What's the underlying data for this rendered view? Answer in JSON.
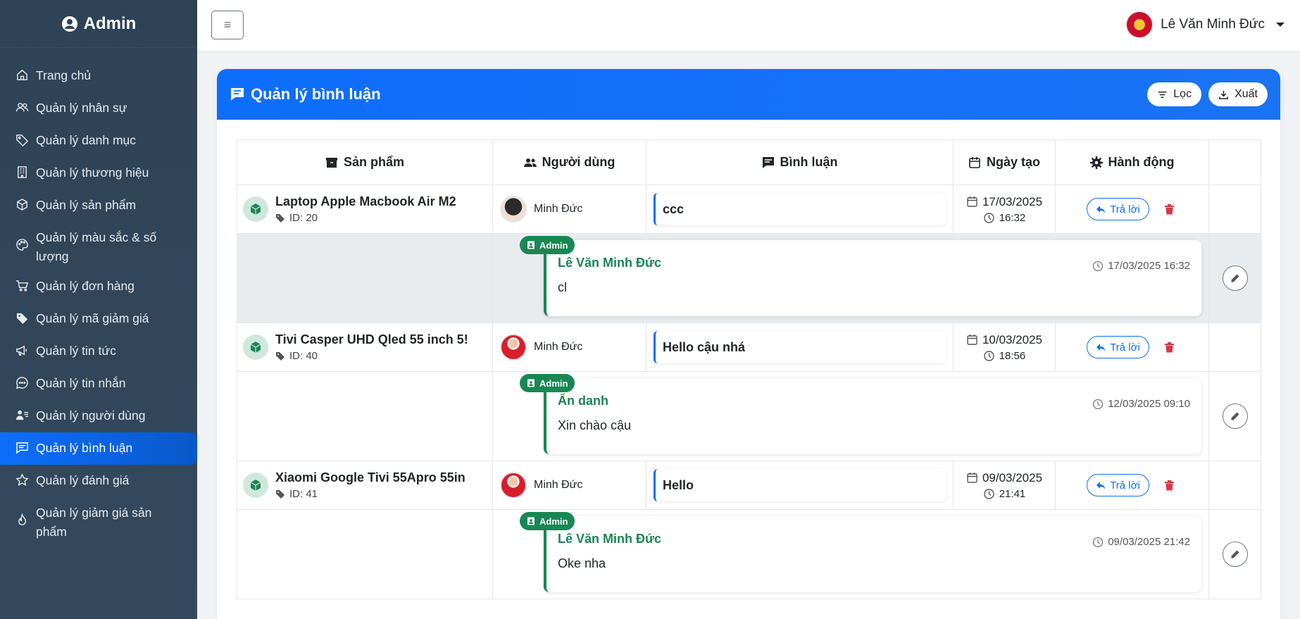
{
  "brand": {
    "title": "Admin",
    "icon": "user-circle-icon"
  },
  "sidebar": {
    "items": [
      {
        "label": "Trang chủ",
        "icon": "home-icon"
      },
      {
        "label": "Quản lý nhân sự",
        "icon": "users-icon"
      },
      {
        "label": "Quản lý danh mục",
        "icon": "tag-icon"
      },
      {
        "label": "Quản lý thương hiệu",
        "icon": "building-icon"
      },
      {
        "label": "Quản lý sản phẩm",
        "icon": "box-icon"
      },
      {
        "label": "Quản lý màu sắc & số lượng",
        "icon": "palette-icon"
      },
      {
        "label": "Quản lý đơn hàng",
        "icon": "cart-icon"
      },
      {
        "label": "Quản lý mã giảm giá",
        "icon": "tag-fill-icon"
      },
      {
        "label": "Quản lý tin tức",
        "icon": "megaphone-icon"
      },
      {
        "label": "Quản lý tin nhắn",
        "icon": "chat-dots-icon"
      },
      {
        "label": "Quản lý người dùng",
        "icon": "person-lines-icon"
      },
      {
        "label": "Quản lý bình luận",
        "icon": "chat-square-icon",
        "active": true
      },
      {
        "label": "Quản lý đánh giá",
        "icon": "star-icon"
      },
      {
        "label": "Quản lý giảm giá sản phẩm",
        "icon": "fire-icon"
      }
    ]
  },
  "topbar": {
    "user_name": "Lê Văn Minh Đức"
  },
  "card": {
    "title": "Quản lý bình luận",
    "filter_label": "Lọc",
    "export_label": "Xuất"
  },
  "table": {
    "headers": {
      "product": "Sản phẩm",
      "user": "Người dùng",
      "comment": "Bình luận",
      "created": "Ngày tạo",
      "action": "Hành động"
    },
    "rows": [
      {
        "product": "Laptop Apple Macbook Air M2",
        "product_id": "ID: 20",
        "user": "Minh Đức",
        "comment": "ccc",
        "date": "17/03/2025",
        "time": "16:32",
        "reply_label": "Trả lời",
        "reply": {
          "badge": "Admin",
          "name": "Lê Văn Minh Đức",
          "time": "17/03/2025 16:32",
          "text": "cl"
        }
      },
      {
        "product": "Tivi Casper UHD Qled 55 inch 5!",
        "product_id": "ID: 40",
        "user": "Minh Đức",
        "comment": "Hello cậu nhá",
        "date": "10/03/2025",
        "time": "18:56",
        "reply_label": "Trả lời",
        "reply": {
          "badge": "Admin",
          "name": "Ẩn danh",
          "time": "12/03/2025 09:10",
          "text": "Xin chào cậu"
        }
      },
      {
        "product": "Xiaomi Google Tivi 55Apro 55in",
        "product_id": "ID: 41",
        "user": "Minh Đức",
        "comment": "Hello",
        "date": "09/03/2025",
        "time": "21:41",
        "reply_label": "Trả lời",
        "reply": {
          "badge": "Admin",
          "name": "Lê Văn Minh Đức",
          "time": "09/03/2025 21:42",
          "text": "Oke nha"
        }
      }
    ]
  },
  "colors": {
    "sidebar": "#2f4356",
    "accent": "#0d6efd",
    "success": "#198754",
    "danger": "#dc3545"
  }
}
